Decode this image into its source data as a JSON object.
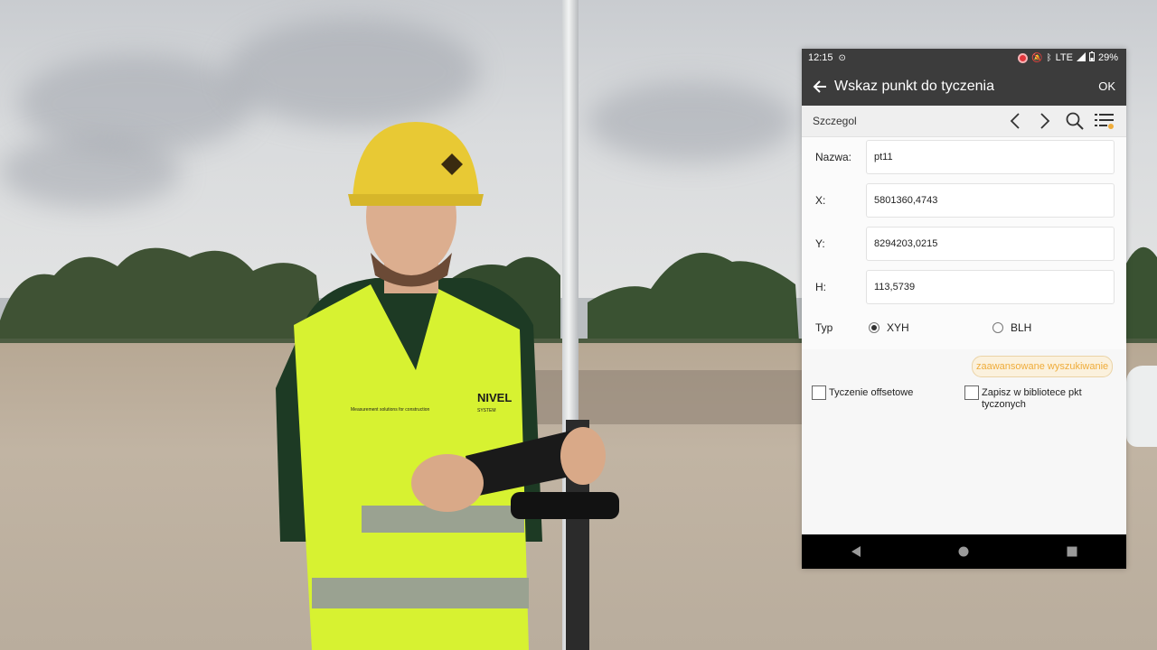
{
  "status_bar": {
    "time": "12:15",
    "network": "LTE",
    "battery": "29%"
  },
  "app_bar": {
    "title": "Wskaz punkt do tyczenia",
    "ok_label": "OK"
  },
  "toolbar": {
    "tab_label": "Szczegol",
    "icons": [
      "chevron-left-icon",
      "chevron-right-icon",
      "search-icon",
      "list-settings-icon"
    ]
  },
  "form": {
    "name": {
      "label": "Nazwa:",
      "value": "pt11"
    },
    "x": {
      "label": "X:",
      "value": "5801360,4743"
    },
    "y": {
      "label": "Y:",
      "value": "8294203,0215"
    },
    "h": {
      "label": "H:",
      "value": "113,5739"
    }
  },
  "type": {
    "label": "Typ",
    "options": [
      "XYH",
      "BLH"
    ],
    "selected": "XYH"
  },
  "advanced_search_label": "zaawansowane wyszukiwanie",
  "checkboxes": {
    "offset": {
      "label": "Tyczenie offsetowe",
      "checked": false
    },
    "save_library": {
      "label": "Zapisz w bibliotece pkt tyczonych",
      "checked": false
    }
  },
  "colors": {
    "app_bar": "#3c3c3c",
    "accent": "#efac3a",
    "record": "#e2363c"
  },
  "vest_text": {
    "brand": "NIVEL",
    "sub": "SYSTEM",
    "slogan": "Measurement solutions for construction"
  }
}
